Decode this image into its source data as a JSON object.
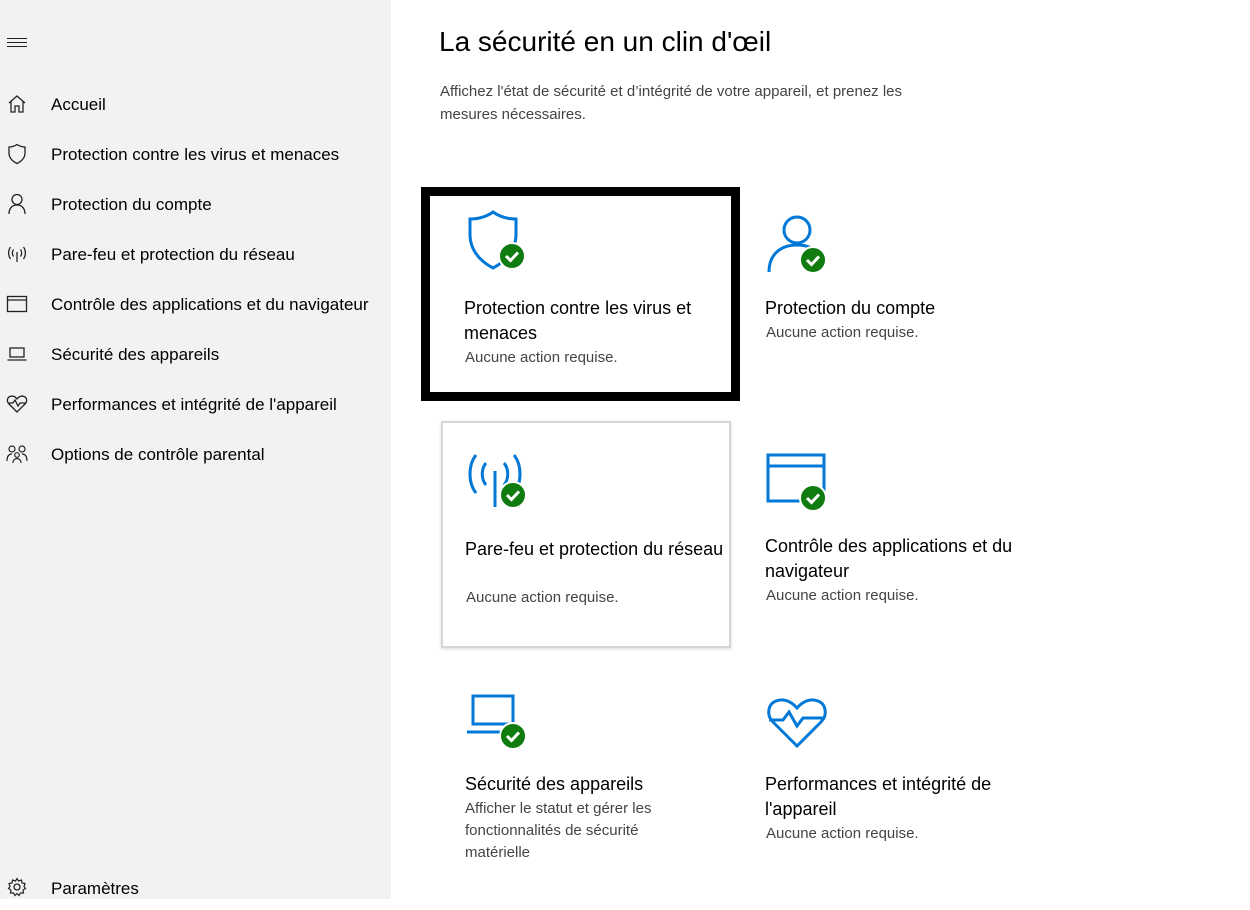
{
  "sidebar": {
    "items": [
      {
        "label": "Accueil",
        "icon": "home-icon"
      },
      {
        "label": "Protection contre les virus et menaces",
        "icon": "shield-icon"
      },
      {
        "label": "Protection du compte",
        "icon": "person-icon"
      },
      {
        "label": "Pare-feu et protection du réseau",
        "icon": "wireless-icon"
      },
      {
        "label": "Contrôle des applications et du navigateur",
        "icon": "browser-window-icon"
      },
      {
        "label": "Sécurité des appareils",
        "icon": "laptop-icon"
      },
      {
        "label": "Performances et intégrité de l'appareil",
        "icon": "heart-icon"
      },
      {
        "label": "Options de contrôle parental",
        "icon": "family-icon"
      }
    ],
    "settings_label": "Paramètres"
  },
  "main": {
    "title": "La sécurité en un clin d'œil",
    "description": "Affichez l'état de sécurité et d’intégrité de votre appareil, et prenez les mesures nécessaires.",
    "tiles": [
      {
        "title": "Protection contre les virus et menaces",
        "status": "Aucune action requise."
      },
      {
        "title": "Protection du compte",
        "status": "Aucune action requise."
      },
      {
        "title": "Pare-feu et protection du réseau",
        "status": "Aucune action requise."
      },
      {
        "title": "Contrôle des applications et du navigateur",
        "status": "Aucune action requise."
      },
      {
        "title": "Sécurité des appareils",
        "status": "Afficher le statut et gérer les fonctionnalités de sécurité matérielle"
      },
      {
        "title": "Performances et intégrité de l'appareil",
        "status": "Aucune action requise."
      }
    ]
  },
  "colors": {
    "accent": "#0078d7",
    "ok": "#107c10",
    "sidebar_bg": "#f2f2f2"
  }
}
